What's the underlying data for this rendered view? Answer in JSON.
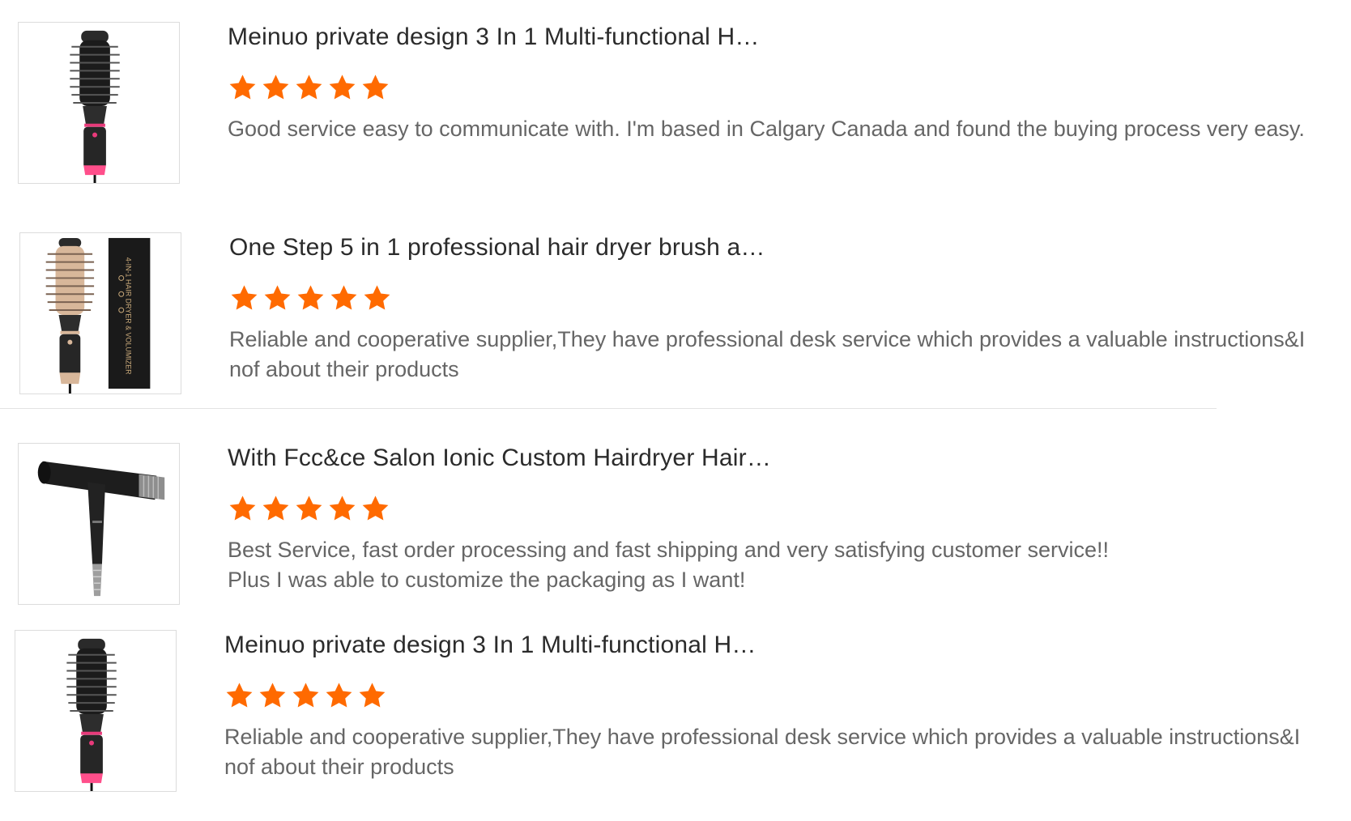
{
  "colors": {
    "star": "#ff6a00",
    "title": "#2b2b2b",
    "comment": "#666666"
  },
  "reviews": [
    {
      "title": "Meinuo private design 3 In 1 Multi-functional H…",
      "rating": 5,
      "comment": "Good service easy to communicate with. I'm based in Calgary Canada and found the buying process very easy.",
      "image": "round-brush-pink-icon"
    },
    {
      "title": "One Step 5 in 1 professional hair dryer brush a…",
      "rating": 5,
      "comment": "Reliable and cooperative supplier,They have professional desk service which provides a valuable instructions&Inof about their products",
      "image": "gold-brush-with-box-icon",
      "box_label": "4-IN-1 HAIR DRYER & VOLUMIZER"
    },
    {
      "title": "With Fcc&ce Salon Ionic Custom Hairdryer Hair…",
      "rating": 5,
      "comment_lines": [
        "Best Service, fast order processing and fast shipping and very satisfying customer service!!",
        "Plus I was able to customize the packaging as I want!"
      ],
      "image": "t-shape-hairdryer-icon"
    },
    {
      "title": "Meinuo private design 3 In 1 Multi-functional H…",
      "rating": 5,
      "comment": "Reliable and cooperative supplier,They have professional desk service which provides a valuable instructions&Inof about their products",
      "image": "round-brush-pink-icon"
    }
  ]
}
